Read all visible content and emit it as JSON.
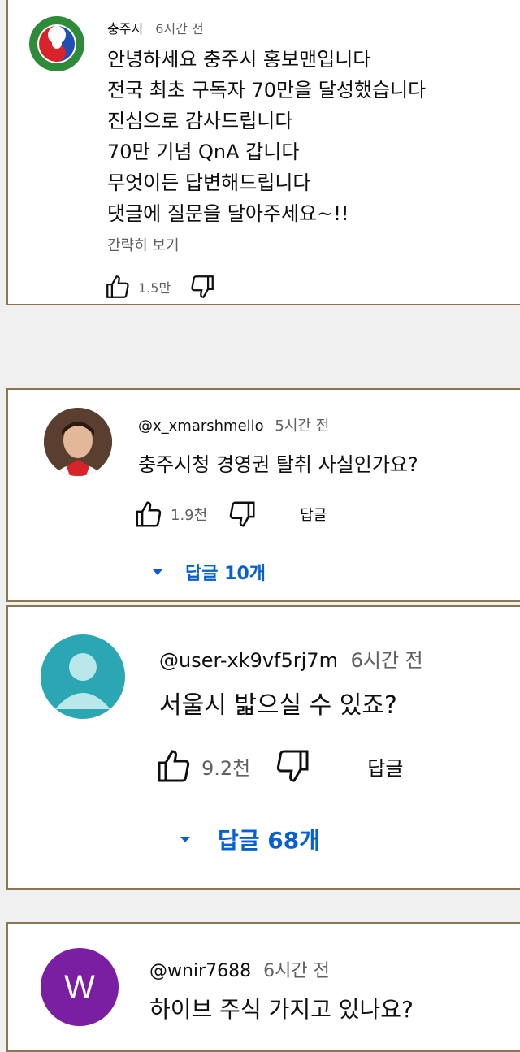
{
  "comments": [
    {
      "author": "충주시",
      "time": "6시간 전",
      "lines": [
        "안녕하세요 충주시 홍보맨입니다",
        "전국 최초 구독자 70만을 달성했습니다",
        "진심으로 감사드립니다",
        "70만 기념 QnA 갑니다",
        "무엇이든 답변해드립니다",
        "댓글에 질문을 달아주세요~!!"
      ],
      "show_less": "간략히 보기",
      "likes": "1.5만",
      "avatar_icon": "chungju-logo-icon"
    },
    {
      "author": "@x_xmarshmello",
      "time": "5시간 전",
      "text": "충주시청 경영권 탈취 사실인가요?",
      "likes": "1.9천",
      "reply_label": "답글",
      "replies_label": "답글 10개",
      "avatar_icon": "profile-photo-icon"
    },
    {
      "author": "@user-xk9vf5rj7m",
      "time": "6시간 전",
      "text": "서울시 밟으실 수 있죠?",
      "likes": "9.2천",
      "reply_label": "답글",
      "replies_label": "답글 68개",
      "avatar_icon": "default-user-icon",
      "avatar_color": "#2aa7b2"
    },
    {
      "author": "@wnir7688",
      "time": "6시간 전",
      "text": "하이브 주식 가지고 있나요?",
      "avatar_letter": "W",
      "avatar_color": "#7b1fa2"
    }
  ],
  "colors": {
    "link_blue": "#065fd4",
    "card_border": "#8a7650",
    "background": "#f0f0f0"
  }
}
